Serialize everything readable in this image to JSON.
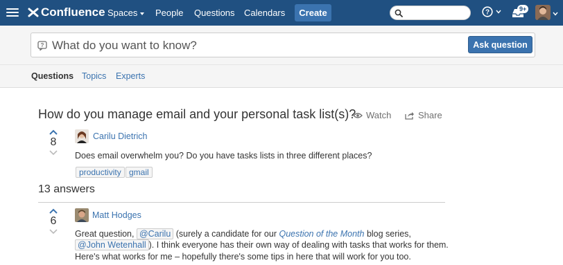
{
  "header": {
    "logo": "Confluence",
    "nav": [
      "Spaces",
      "People",
      "Questions",
      "Calendars"
    ],
    "create_label": "Create",
    "search_placeholder": "",
    "notifications_badge": "9+",
    "brand_color": "#205081"
  },
  "ask": {
    "placeholder": "What do you want to know?",
    "button_label": "Ask question"
  },
  "tabs": [
    {
      "label": "Questions",
      "active": true
    },
    {
      "label": "Topics",
      "active": false
    },
    {
      "label": "Experts",
      "active": false
    }
  ],
  "question": {
    "title": "How do you manage email and your personal task list(s)?",
    "watch_label": "Watch",
    "share_label": "Share",
    "votes": "8",
    "author": "Carilu Dietrich",
    "body": "Does email overwhelm you? Do you have tasks lists in three different places?",
    "labels": [
      "productivity",
      "gmail"
    ]
  },
  "answers_count_label": "13 answers",
  "answer": {
    "votes": "6",
    "author": "Matt Hodges",
    "line1_pre": "Great question, ",
    "mention1": "@Carilu",
    "line1_mid": " (surely a candidate for our ",
    "line1_link": "Question of the Month",
    "line1_post": " blog series,",
    "mention2": "@John Wetenhall",
    "line2_post": "). I think everyone has their own way of dealing with tasks that works for them.",
    "line3": "Here's what works for me – hopefully there's some tips in here that will work for you too."
  }
}
